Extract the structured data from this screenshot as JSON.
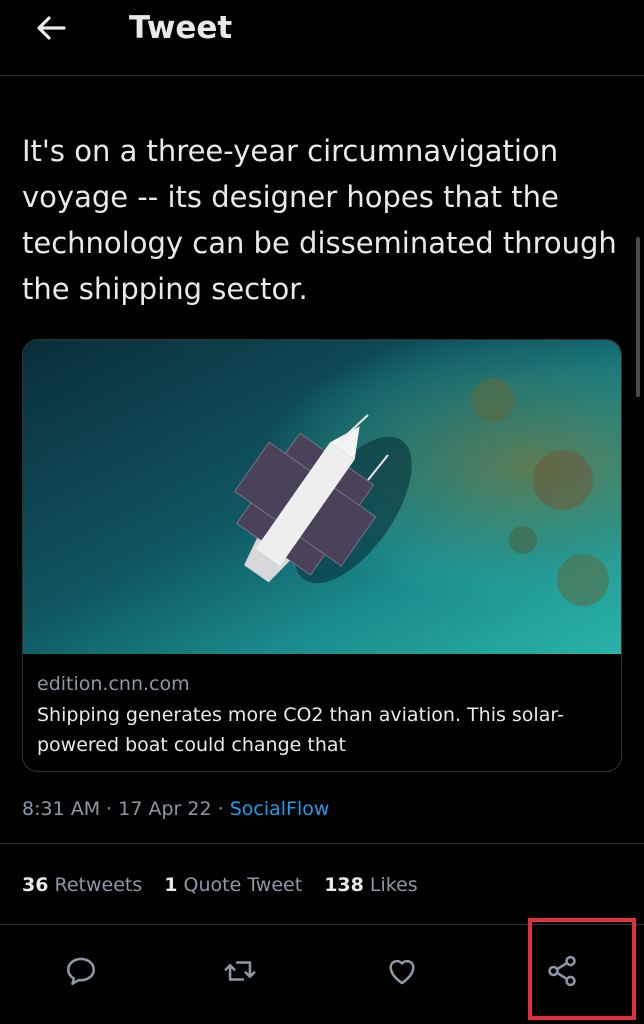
{
  "header": {
    "title": "Tweet",
    "back_icon": "arrow-left-icon"
  },
  "tweet": {
    "text": "It's on a three-year circumnavigation voyage -- its designer hopes that the technology can be disseminated through the shipping sector."
  },
  "card": {
    "image_description_icon": "solar-boat-aerial-photo",
    "domain": "edition.cnn.com",
    "title": "Shipping generates more CO2 than aviation. This solar-powered boat could change that"
  },
  "meta": {
    "time": "8:31 AM",
    "separator": "·",
    "date": "17 Apr 22",
    "source": "SocialFlow"
  },
  "stats": {
    "retweets_count": "36",
    "retweets_label": "Retweets",
    "quotes_count": "1",
    "quotes_label": "Quote Tweet",
    "likes_count": "138",
    "likes_label": "Likes"
  },
  "actions": {
    "reply_icon": "reply-icon",
    "retweet_icon": "retweet-icon",
    "like_icon": "heart-icon",
    "share_icon": "share-icon"
  },
  "colors": {
    "background": "#000000",
    "text": "#e7e9ea",
    "secondary": "#8b98a5",
    "link": "#1d9bf0",
    "highlight": "#e0303f"
  }
}
